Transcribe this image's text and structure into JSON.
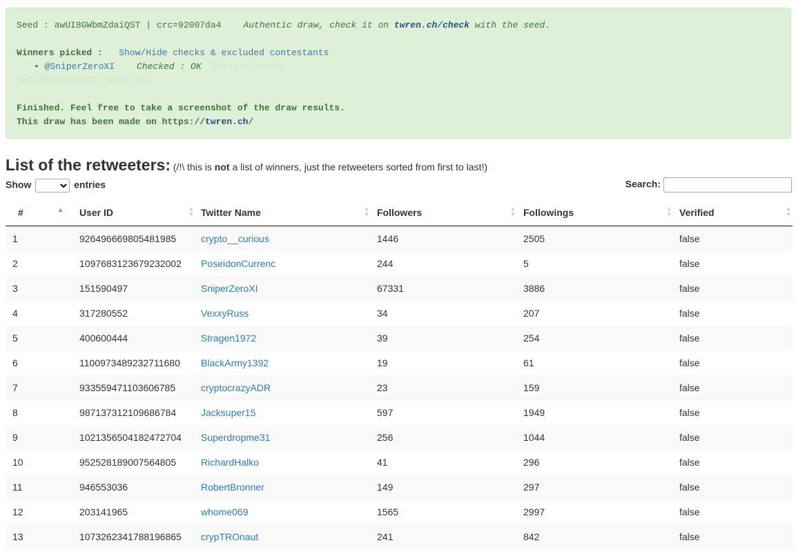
{
  "alert": {
    "seed_text": "Seed : awUI8GWbmZdaiQST | crc=92007da4",
    "auth_pre": "Authentic draw, check it on ",
    "auth_link": "twren.ch/check",
    "auth_post": " with the seed.",
    "winners_label": "Winners picked :",
    "toggle_link": "Show/Hide checks & excluded contestants",
    "winner_handle": "@SniperZeroXI",
    "winner_status": "Checked : OK",
    "winner_ghost": "@SniperZeroXI",
    "ghost_line": "awUI8GWbmZdaiQST|92007da4",
    "finished_text": "Finished. Feel free to take a screenshot of the draw results.",
    "made_pre": "This draw has been made on https://",
    "made_link": "twren.ch",
    "made_post": "/"
  },
  "heading": {
    "title": "List of the retweeters:",
    "sub_pre": " (/!\\ this is ",
    "sub_bold": "not",
    "sub_post": " a list of winners, just the retweeters sorted from first to last!)"
  },
  "controls": {
    "show_label": "Show",
    "entries_label": "entries",
    "search_label": "Search:"
  },
  "table": {
    "columns": [
      "#",
      "User ID",
      "Twitter Name",
      "Followers",
      "Followings",
      "Verified"
    ],
    "rows": [
      [
        "1",
        "926496669805481985",
        "crypto__curious",
        "1446",
        "2505",
        "false"
      ],
      [
        "2",
        "1097683123679232002",
        "PoseidonCurrenc",
        "244",
        "5",
        "false"
      ],
      [
        "3",
        "151590497",
        "SniperZeroXI",
        "67331",
        "3886",
        "false"
      ],
      [
        "4",
        "317280552",
        "VexxyRuss",
        "34",
        "207",
        "false"
      ],
      [
        "5",
        "400600444",
        "Stragen1972",
        "39",
        "254",
        "false"
      ],
      [
        "6",
        "1100973489232711680",
        "BlackArmy1392",
        "19",
        "61",
        "false"
      ],
      [
        "7",
        "933559471103606785",
        "cryptocrazyADR",
        "23",
        "159",
        "false"
      ],
      [
        "8",
        "987137312109686784",
        "Jacksuper15",
        "597",
        "1949",
        "false"
      ],
      [
        "9",
        "1021356504182472704",
        "Superdropme31",
        "256",
        "1044",
        "false"
      ],
      [
        "10",
        "952528189007564805",
        "RichardHalko",
        "41",
        "296",
        "false"
      ],
      [
        "11",
        "946553036",
        "RobertBronner",
        "149",
        "297",
        "false"
      ],
      [
        "12",
        "203141965",
        "whome069",
        "1565",
        "2997",
        "false"
      ],
      [
        "13",
        "1073262341788196865",
        "crypTROnaut",
        "241",
        "842",
        "false"
      ]
    ]
  }
}
